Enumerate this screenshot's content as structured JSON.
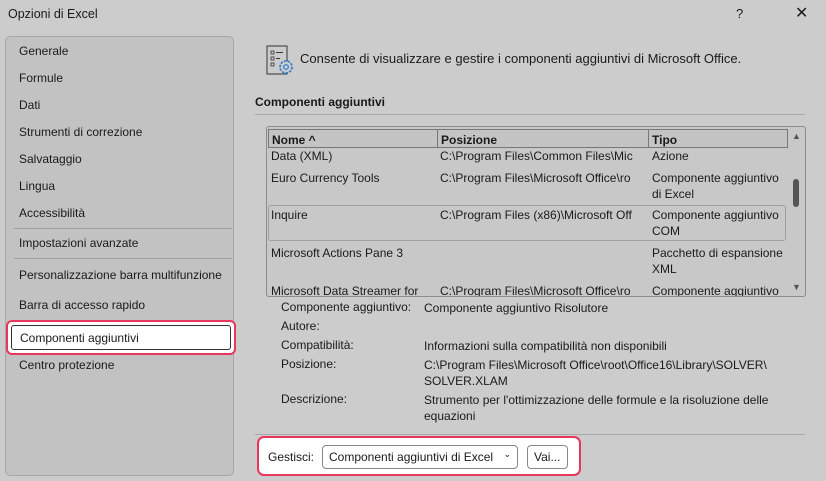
{
  "window": {
    "title": "Opzioni di Excel",
    "help": "?",
    "close": "✕"
  },
  "sidebar": {
    "items": [
      "Generale",
      "Formule",
      "Dati",
      "Strumenti di correzione",
      "Salvataggio",
      "Lingua",
      "Accessibilità",
      "Impostazioni avanzate",
      "Personalizzazione barra multifunzione",
      "Barra di accesso rapido",
      "Componenti aggiuntivi",
      "Centro protezione"
    ],
    "selected": "Componenti aggiuntivi"
  },
  "main": {
    "intro": "Consente di visualizzare e gestire i componenti aggiuntivi di Microsoft Office.",
    "heading": "Componenti aggiuntivi",
    "columns": [
      "Nome ^",
      "Posizione",
      "Tipo"
    ],
    "rows": [
      [
        "Data (XML)",
        "C:\\Program Files\\Common Files\\Mic",
        "Azione"
      ],
      [
        "Euro Currency Tools",
        "C:\\Program Files\\Microsoft Office\\ro",
        "Componente aggiuntivo di Excel"
      ],
      [
        "Inquire",
        "C:\\Program Files (x86)\\Microsoft Off",
        "Componente aggiuntivo COM"
      ],
      [
        "Microsoft Actions Pane 3",
        "",
        "Pacchetto di espansione XML"
      ],
      [
        "Microsoft Data Streamer for",
        "C:\\Program Files\\Microsoft Office\\ro",
        "Componente aggiuntivo"
      ]
    ],
    "details": [
      {
        "label": "Componente aggiuntivo:",
        "value": "Componente aggiuntivo Risolutore"
      },
      {
        "label": "Autore:",
        "value": ""
      },
      {
        "label": "Compatibilità:",
        "value": "Informazioni sulla compatibilità non disponibili"
      },
      {
        "label": "Posizione:",
        "value": "C:\\Program Files\\Microsoft Office\\root\\Office16\\Library\\SOLVER\\ SOLVER.XLAM"
      },
      {
        "label": "Descrizione:",
        "value": "Strumento per l'ottimizzazione delle formule e la risoluzione delle equazioni"
      }
    ],
    "manage_label": "Gestisci:",
    "manage_value": "Componenti aggiuntivi di Excel",
    "go": "Vai..."
  }
}
